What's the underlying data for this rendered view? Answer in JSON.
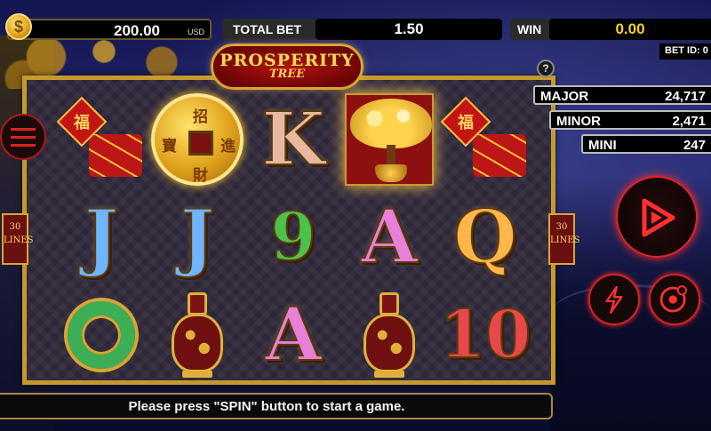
{
  "header": {
    "balance": "200.00",
    "currency": "USD",
    "coin_symbol": "$",
    "total_bet_label": "TOTAL BET",
    "total_bet_value": "1.50",
    "win_label": "WIN",
    "win_value": "0.00",
    "bet_id_label": "BET ID: 0"
  },
  "logo": {
    "title": "PROSPERITY",
    "subtitle": "TREE"
  },
  "help": {
    "label": "?"
  },
  "lines_badge": {
    "count": "30",
    "label": "LINES"
  },
  "lantern_char": "福",
  "coin_chars": {
    "top": "招",
    "right": "進",
    "bottom": "財",
    "left": "寶"
  },
  "reels": [
    [
      "lantern-fireworks",
      "coin",
      "K",
      "tree",
      "lantern-fireworks"
    ],
    [
      "J",
      "J",
      "9",
      "A",
      "Q"
    ],
    [
      "jade",
      "vase",
      "A",
      "vase",
      "10"
    ]
  ],
  "symbol_colors": {
    "K": "#e9b8a0",
    "J": "#6fb5ff",
    "9": "#4cc24c",
    "A": "#e880d8",
    "Q": "#ffb64a",
    "10": "#e84848"
  },
  "jackpots": [
    {
      "label": "MAJOR",
      "value": "24,717"
    },
    {
      "label": "MINOR",
      "value": "2,471"
    },
    {
      "label": "MINI",
      "value": "247"
    }
  ],
  "controls": {
    "spin_icon": "spin-play-icon",
    "turbo_icon": "lightning-icon",
    "auto_icon": "autoplay-gear-icon",
    "menu_icon": "hamburger-menu-icon"
  },
  "message": "Please press \"SPIN\" button to start a game."
}
